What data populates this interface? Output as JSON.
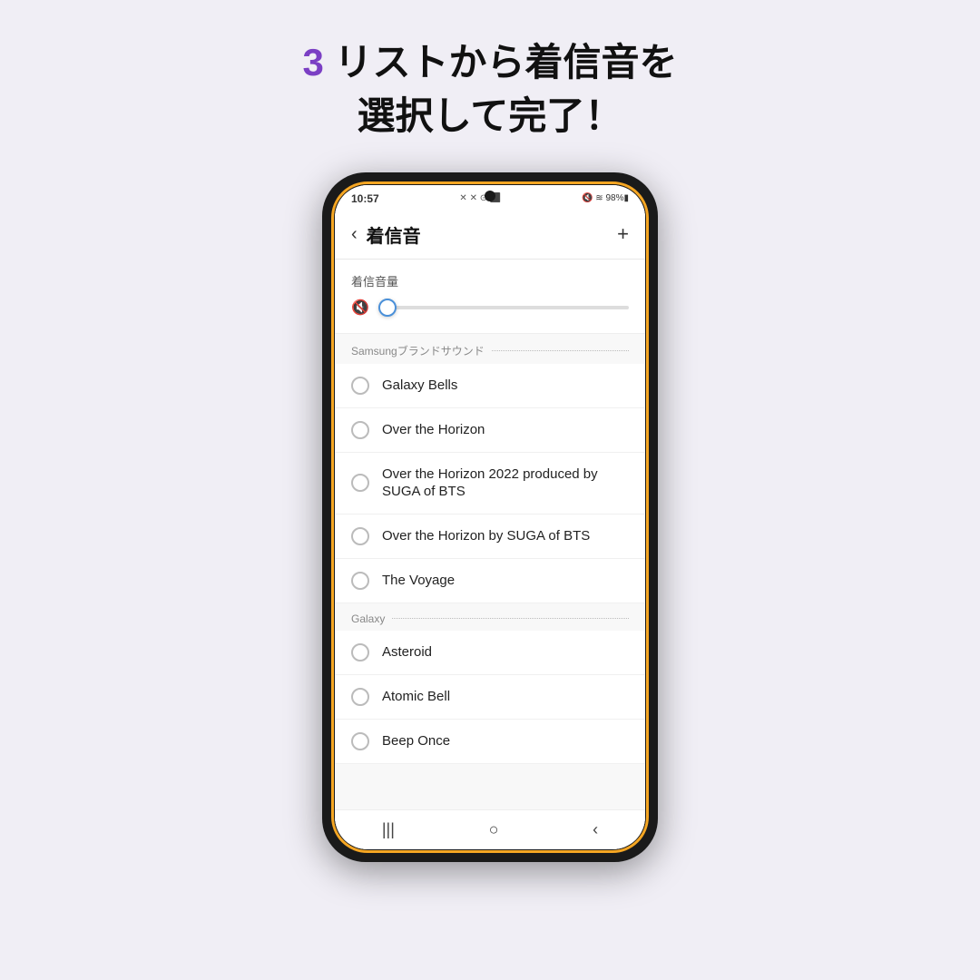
{
  "page": {
    "background_color": "#f0eef5"
  },
  "header": {
    "step_number": "3",
    "step_number_color": "#7b3fc4",
    "text_line1": " リストから着信音を",
    "text_line2": "選択して完了！"
  },
  "phone": {
    "status_bar": {
      "time": "10:57",
      "left_icons": "✕ ✕ 🔔 ⊙ 📷 ■",
      "right_icons": "🔇 📶 98%🔋"
    },
    "app_header": {
      "back_icon": "‹",
      "title": "着信音",
      "add_icon": "+"
    },
    "volume": {
      "label": "着信音量",
      "mute_icon": "🔇"
    },
    "sections": [
      {
        "name": "Samsungブランドサウンド",
        "items": [
          {
            "label": "Galaxy Bells"
          },
          {
            "label": "Over the Horizon"
          },
          {
            "label": "Over the Horizon 2022 produced\nby SUGA of BTS"
          },
          {
            "label": "Over the Horizon by SUGA of BTS"
          },
          {
            "label": "The Voyage"
          }
        ]
      },
      {
        "name": "Galaxy",
        "items": [
          {
            "label": "Asteroid"
          },
          {
            "label": "Atomic Bell"
          },
          {
            "label": "Beep Once"
          }
        ]
      }
    ],
    "nav": {
      "recent_icon": "|||",
      "home_icon": "○",
      "back_icon": "‹"
    }
  }
}
